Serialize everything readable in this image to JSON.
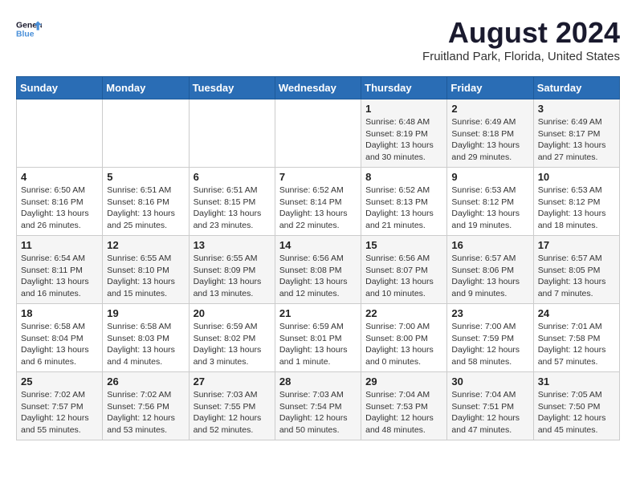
{
  "header": {
    "logo_line1": "General",
    "logo_line2": "Blue",
    "title": "August 2024",
    "subtitle": "Fruitland Park, Florida, United States"
  },
  "weekdays": [
    "Sunday",
    "Monday",
    "Tuesday",
    "Wednesday",
    "Thursday",
    "Friday",
    "Saturday"
  ],
  "weeks": [
    [
      {
        "day": "",
        "info": ""
      },
      {
        "day": "",
        "info": ""
      },
      {
        "day": "",
        "info": ""
      },
      {
        "day": "",
        "info": ""
      },
      {
        "day": "1",
        "info": "Sunrise: 6:48 AM\nSunset: 8:19 PM\nDaylight: 13 hours\nand 30 minutes."
      },
      {
        "day": "2",
        "info": "Sunrise: 6:49 AM\nSunset: 8:18 PM\nDaylight: 13 hours\nand 29 minutes."
      },
      {
        "day": "3",
        "info": "Sunrise: 6:49 AM\nSunset: 8:17 PM\nDaylight: 13 hours\nand 27 minutes."
      }
    ],
    [
      {
        "day": "4",
        "info": "Sunrise: 6:50 AM\nSunset: 8:16 PM\nDaylight: 13 hours\nand 26 minutes."
      },
      {
        "day": "5",
        "info": "Sunrise: 6:51 AM\nSunset: 8:16 PM\nDaylight: 13 hours\nand 25 minutes."
      },
      {
        "day": "6",
        "info": "Sunrise: 6:51 AM\nSunset: 8:15 PM\nDaylight: 13 hours\nand 23 minutes."
      },
      {
        "day": "7",
        "info": "Sunrise: 6:52 AM\nSunset: 8:14 PM\nDaylight: 13 hours\nand 22 minutes."
      },
      {
        "day": "8",
        "info": "Sunrise: 6:52 AM\nSunset: 8:13 PM\nDaylight: 13 hours\nand 21 minutes."
      },
      {
        "day": "9",
        "info": "Sunrise: 6:53 AM\nSunset: 8:12 PM\nDaylight: 13 hours\nand 19 minutes."
      },
      {
        "day": "10",
        "info": "Sunrise: 6:53 AM\nSunset: 8:12 PM\nDaylight: 13 hours\nand 18 minutes."
      }
    ],
    [
      {
        "day": "11",
        "info": "Sunrise: 6:54 AM\nSunset: 8:11 PM\nDaylight: 13 hours\nand 16 minutes."
      },
      {
        "day": "12",
        "info": "Sunrise: 6:55 AM\nSunset: 8:10 PM\nDaylight: 13 hours\nand 15 minutes."
      },
      {
        "day": "13",
        "info": "Sunrise: 6:55 AM\nSunset: 8:09 PM\nDaylight: 13 hours\nand 13 minutes."
      },
      {
        "day": "14",
        "info": "Sunrise: 6:56 AM\nSunset: 8:08 PM\nDaylight: 13 hours\nand 12 minutes."
      },
      {
        "day": "15",
        "info": "Sunrise: 6:56 AM\nSunset: 8:07 PM\nDaylight: 13 hours\nand 10 minutes."
      },
      {
        "day": "16",
        "info": "Sunrise: 6:57 AM\nSunset: 8:06 PM\nDaylight: 13 hours\nand 9 minutes."
      },
      {
        "day": "17",
        "info": "Sunrise: 6:57 AM\nSunset: 8:05 PM\nDaylight: 13 hours\nand 7 minutes."
      }
    ],
    [
      {
        "day": "18",
        "info": "Sunrise: 6:58 AM\nSunset: 8:04 PM\nDaylight: 13 hours\nand 6 minutes."
      },
      {
        "day": "19",
        "info": "Sunrise: 6:58 AM\nSunset: 8:03 PM\nDaylight: 13 hours\nand 4 minutes."
      },
      {
        "day": "20",
        "info": "Sunrise: 6:59 AM\nSunset: 8:02 PM\nDaylight: 13 hours\nand 3 minutes."
      },
      {
        "day": "21",
        "info": "Sunrise: 6:59 AM\nSunset: 8:01 PM\nDaylight: 13 hours\nand 1 minute."
      },
      {
        "day": "22",
        "info": "Sunrise: 7:00 AM\nSunset: 8:00 PM\nDaylight: 13 hours\nand 0 minutes."
      },
      {
        "day": "23",
        "info": "Sunrise: 7:00 AM\nSunset: 7:59 PM\nDaylight: 12 hours\nand 58 minutes."
      },
      {
        "day": "24",
        "info": "Sunrise: 7:01 AM\nSunset: 7:58 PM\nDaylight: 12 hours\nand 57 minutes."
      }
    ],
    [
      {
        "day": "25",
        "info": "Sunrise: 7:02 AM\nSunset: 7:57 PM\nDaylight: 12 hours\nand 55 minutes."
      },
      {
        "day": "26",
        "info": "Sunrise: 7:02 AM\nSunset: 7:56 PM\nDaylight: 12 hours\nand 53 minutes."
      },
      {
        "day": "27",
        "info": "Sunrise: 7:03 AM\nSunset: 7:55 PM\nDaylight: 12 hours\nand 52 minutes."
      },
      {
        "day": "28",
        "info": "Sunrise: 7:03 AM\nSunset: 7:54 PM\nDaylight: 12 hours\nand 50 minutes."
      },
      {
        "day": "29",
        "info": "Sunrise: 7:04 AM\nSunset: 7:53 PM\nDaylight: 12 hours\nand 48 minutes."
      },
      {
        "day": "30",
        "info": "Sunrise: 7:04 AM\nSunset: 7:51 PM\nDaylight: 12 hours\nand 47 minutes."
      },
      {
        "day": "31",
        "info": "Sunrise: 7:05 AM\nSunset: 7:50 PM\nDaylight: 12 hours\nand 45 minutes."
      }
    ]
  ]
}
